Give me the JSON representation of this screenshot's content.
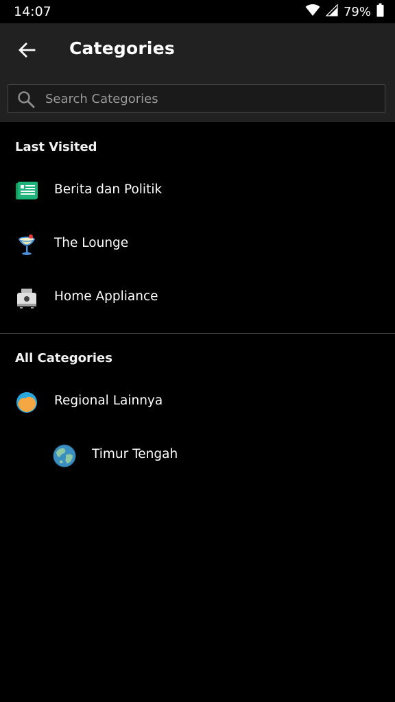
{
  "status_bar": {
    "time": "14:07",
    "battery_percent": "79%",
    "icons": [
      "wifi-icon",
      "signal-icon",
      "battery-icon"
    ]
  },
  "app_bar": {
    "back_icon": "arrow-left-icon",
    "title": "Categories"
  },
  "search": {
    "placeholder": "Search Categories",
    "value": ""
  },
  "last_visited": {
    "header": "Last Visited",
    "items": [
      {
        "label": "Berita dan Politik",
        "icon": "newspaper-icon"
      },
      {
        "label": "The Lounge",
        "icon": "cocktail-glass-icon"
      },
      {
        "label": "Home Appliance",
        "icon": "toaster-icon"
      }
    ]
  },
  "all_categories": {
    "header": "All Categories",
    "items": [
      {
        "label": "Regional Lainnya",
        "icon": "regional-globe-icon",
        "level": 0
      },
      {
        "label": "Timur Tengah",
        "icon": "earth-globe-icon",
        "level": 1
      }
    ]
  },
  "colors": {
    "background": "#000000",
    "app_bar": "#212121",
    "text": "#ffffff",
    "placeholder": "#9a9a9a",
    "divider": "#3a3a3a"
  }
}
